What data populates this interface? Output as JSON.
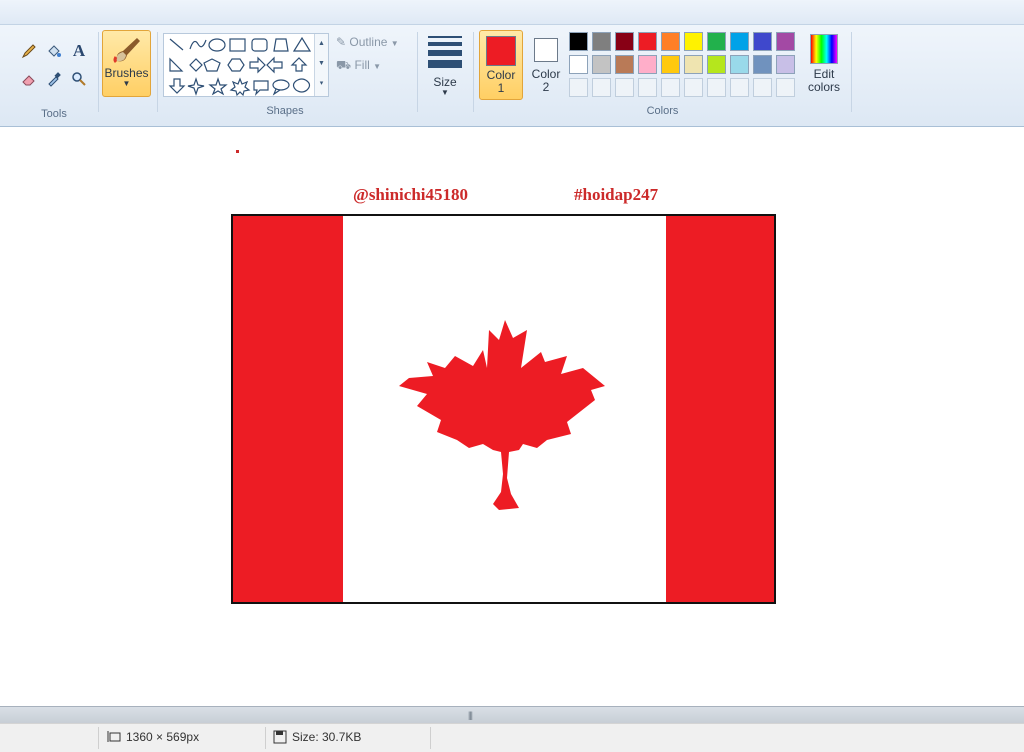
{
  "ribbon": {
    "groups": {
      "tools": "Tools",
      "shapes": "Shapes",
      "colors": "Colors"
    },
    "brushes_label": "Brushes",
    "outline_label": "Outline",
    "fill_label": "Fill",
    "size_label": "Size",
    "color1_label": "Color",
    "color1_num": "1",
    "color2_label": "Color",
    "color2_num": "2",
    "edit_colors_line1": "Edit",
    "edit_colors_line2": "colors",
    "color1_value": "#ed1c24",
    "color2_value": "#ffffff",
    "palette_row1": [
      "#000000",
      "#7f7f7f",
      "#880015",
      "#ed1c24",
      "#ff7f27",
      "#fff200",
      "#22b14c",
      "#00a2e8",
      "#3f48cc",
      "#a349a4"
    ],
    "palette_row2": [
      "#ffffff",
      "#c3c3c3",
      "#b97a57",
      "#ffaec9",
      "#ffc90e",
      "#efe4b0",
      "#b5e61d",
      "#99d9ea",
      "#7092be",
      "#c8bfe7"
    ]
  },
  "canvas": {
    "caption_left": "@shinichi45180",
    "caption_right": "#hoidap247",
    "flag_red": "#ed1c24"
  },
  "status": {
    "dimensions": "1360 × 569px",
    "file_size": "Size: 30.7KB"
  }
}
